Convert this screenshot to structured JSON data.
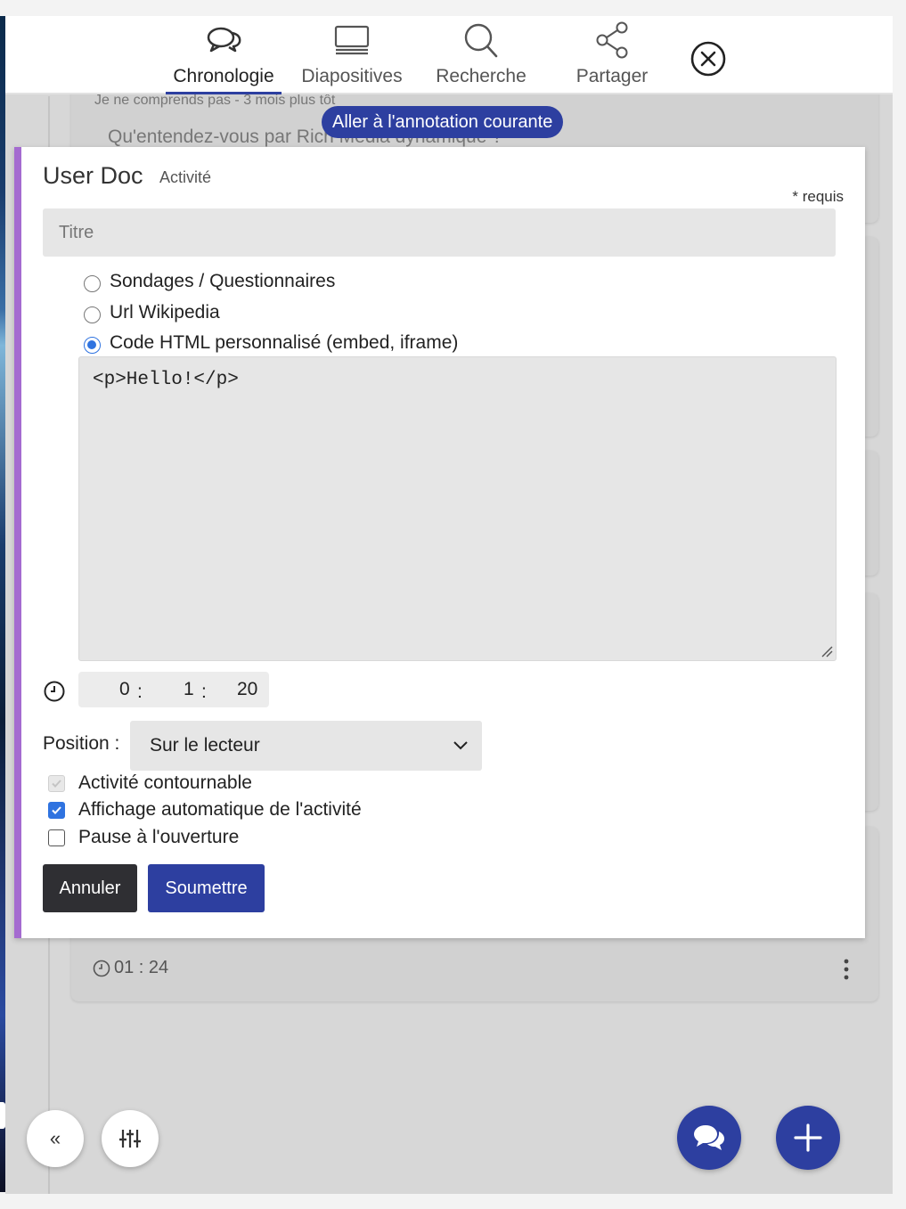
{
  "nav": {
    "tabs": [
      {
        "label": "Chronologie",
        "icon": "chat-bubbles-icon",
        "active": true
      },
      {
        "label": "Diapositives",
        "icon": "slides-icon",
        "active": false
      },
      {
        "label": "Recherche",
        "icon": "search-icon",
        "active": false
      },
      {
        "label": "Partager",
        "icon": "share-icon",
        "active": false
      }
    ],
    "close_icon": "close-circle-icon"
  },
  "background": {
    "comment_meta": "Je ne comprends pas - 3 mois plus tôt",
    "comment_text": "Qu'entendez-vous par Rich Media dynamique ?",
    "jump_pill": "Aller à l'annotation courante",
    "bottom_timestamp": "01 : 24"
  },
  "form": {
    "title": "User Doc",
    "subtitle": "Activité",
    "required_note": "* requis",
    "title_placeholder": "Titre",
    "title_value": "",
    "options": [
      {
        "label": "Sondages / Questionnaires",
        "checked": false
      },
      {
        "label": "Url Wikipedia",
        "checked": false
      },
      {
        "label": "Code HTML personnalisé (embed, iframe)",
        "checked": true
      }
    ],
    "code_value": "<p>Hello!</p>",
    "time": {
      "hours": "0",
      "minutes": "1",
      "seconds": "20",
      "sep": ":"
    },
    "position_label": "Position :",
    "position_value": "Sur le lecteur",
    "checkboxes": [
      {
        "label": "Activité contournable",
        "checked": true,
        "disabled": true
      },
      {
        "label": "Affichage automatique de l'activité",
        "checked": true,
        "disabled": false
      },
      {
        "label": "Pause à l'ouverture",
        "checked": false,
        "disabled": false
      }
    ],
    "cancel_label": "Annuler",
    "submit_label": "Soumettre"
  },
  "footer": {
    "collapse_label": "«"
  },
  "colors": {
    "accent": "#2d3fa0",
    "card_border": "#a46bd0",
    "checkbox_blue": "#2f73e0",
    "cancel_bg": "#2f2f33"
  }
}
